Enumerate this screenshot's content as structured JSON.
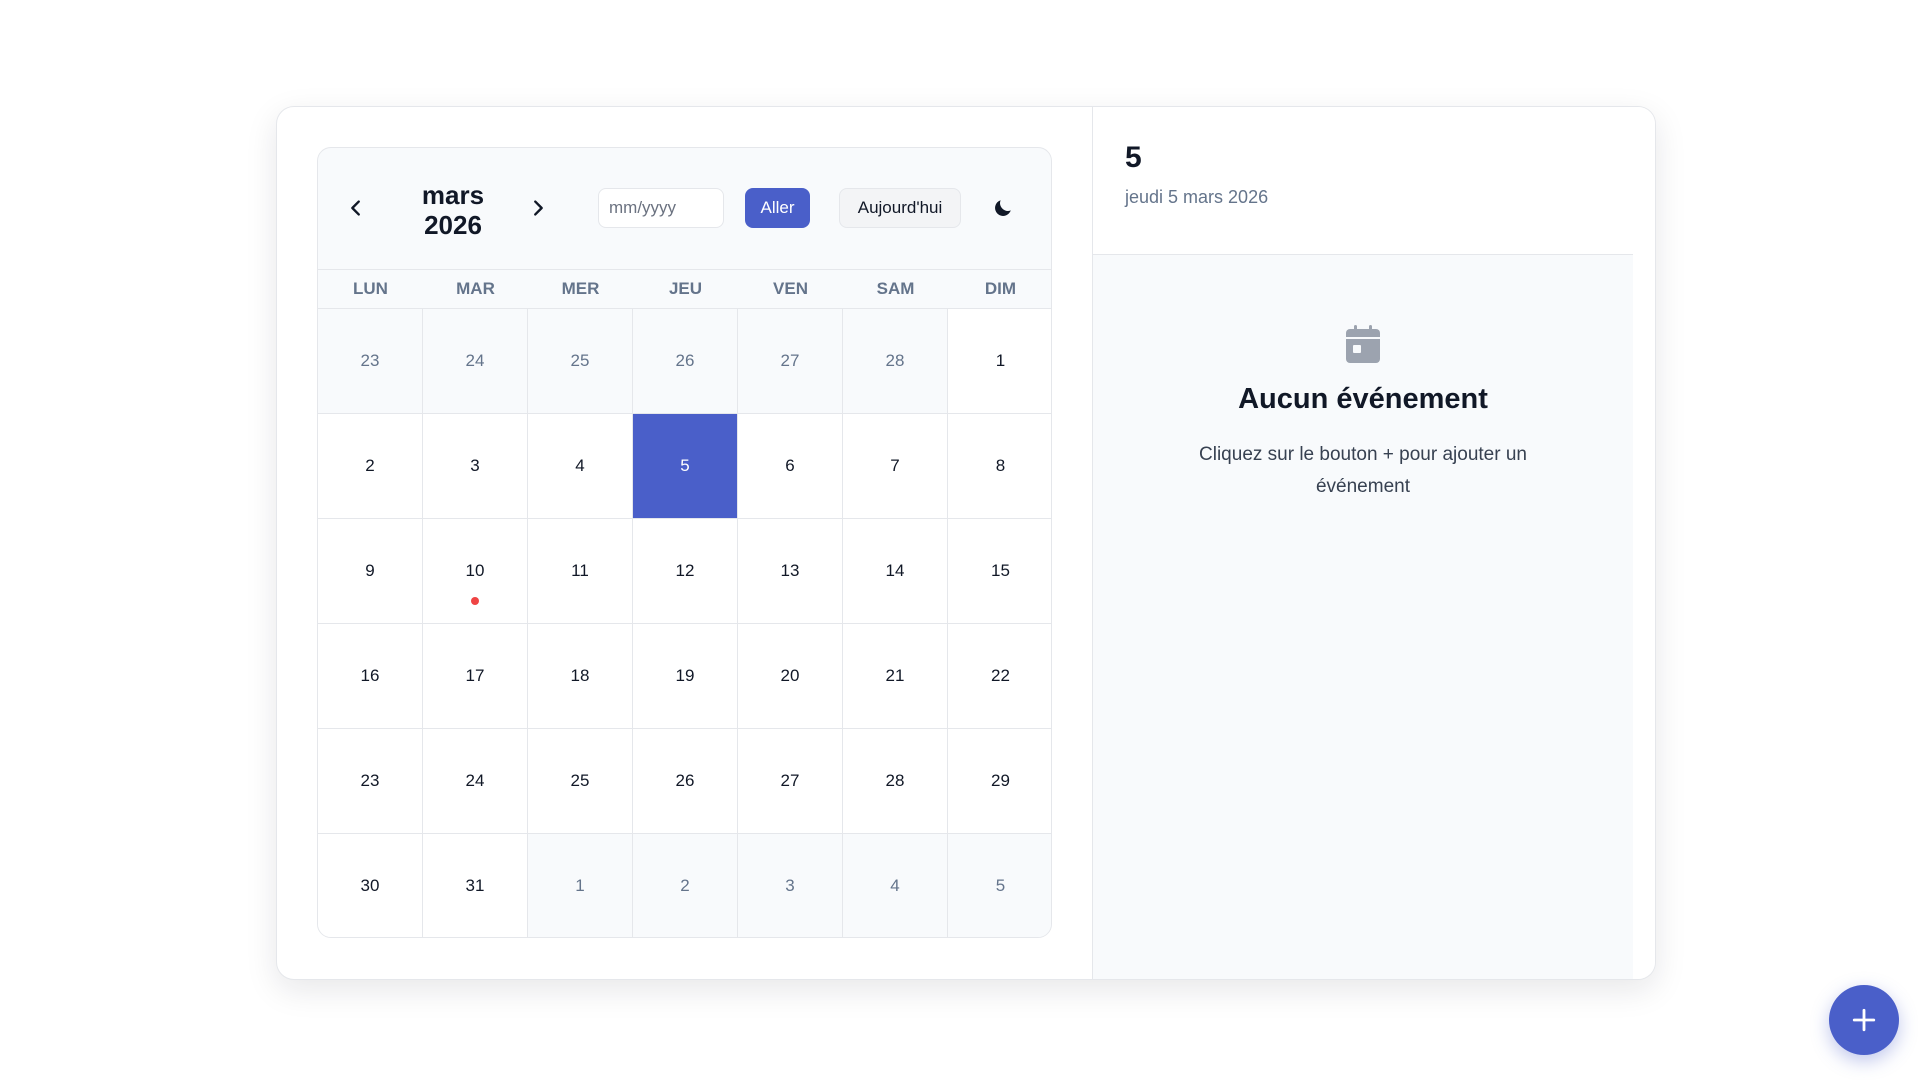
{
  "calendar": {
    "month_line": "mars",
    "year_line": "2026",
    "input_placeholder": "mm/yyyy",
    "go_label": "Aller",
    "today_label": "Aujourd'hui",
    "weekdays": [
      "LUN",
      "MAR",
      "MER",
      "JEU",
      "VEN",
      "SAM",
      "DIM"
    ],
    "days": [
      {
        "label": "23",
        "outside": true
      },
      {
        "label": "24",
        "outside": true
      },
      {
        "label": "25",
        "outside": true
      },
      {
        "label": "26",
        "outside": true
      },
      {
        "label": "27",
        "outside": true
      },
      {
        "label": "28",
        "outside": true
      },
      {
        "label": "1"
      },
      {
        "label": "2"
      },
      {
        "label": "3"
      },
      {
        "label": "4"
      },
      {
        "label": "5",
        "selected": true
      },
      {
        "label": "6"
      },
      {
        "label": "7"
      },
      {
        "label": "8"
      },
      {
        "label": "9"
      },
      {
        "label": "10",
        "has_event": true
      },
      {
        "label": "11"
      },
      {
        "label": "12"
      },
      {
        "label": "13"
      },
      {
        "label": "14"
      },
      {
        "label": "15"
      },
      {
        "label": "16"
      },
      {
        "label": "17"
      },
      {
        "label": "18"
      },
      {
        "label": "19"
      },
      {
        "label": "20"
      },
      {
        "label": "21"
      },
      {
        "label": "22"
      },
      {
        "label": "23"
      },
      {
        "label": "24"
      },
      {
        "label": "25"
      },
      {
        "label": "26"
      },
      {
        "label": "27"
      },
      {
        "label": "28"
      },
      {
        "label": "29"
      },
      {
        "label": "30"
      },
      {
        "label": "31"
      },
      {
        "label": "1",
        "outside": true
      },
      {
        "label": "2",
        "outside": true
      },
      {
        "label": "3",
        "outside": true
      },
      {
        "label": "4",
        "outside": true
      },
      {
        "label": "5",
        "outside": true
      }
    ]
  },
  "detail": {
    "day_number": "5",
    "full_date": "jeudi 5 mars 2026",
    "empty_title": "Aucun événement",
    "empty_text": "Cliquez sur le bouton + pour ajouter un événement"
  },
  "icons": {
    "prev": "chevron-left-icon",
    "next": "chevron-right-icon",
    "theme": "moon-icon",
    "empty": "calendar-icon",
    "fab": "plus-icon"
  },
  "colors": {
    "accent": "#4a5fc9",
    "event_dot": "#ef4444",
    "muted_text": "#64748b"
  }
}
